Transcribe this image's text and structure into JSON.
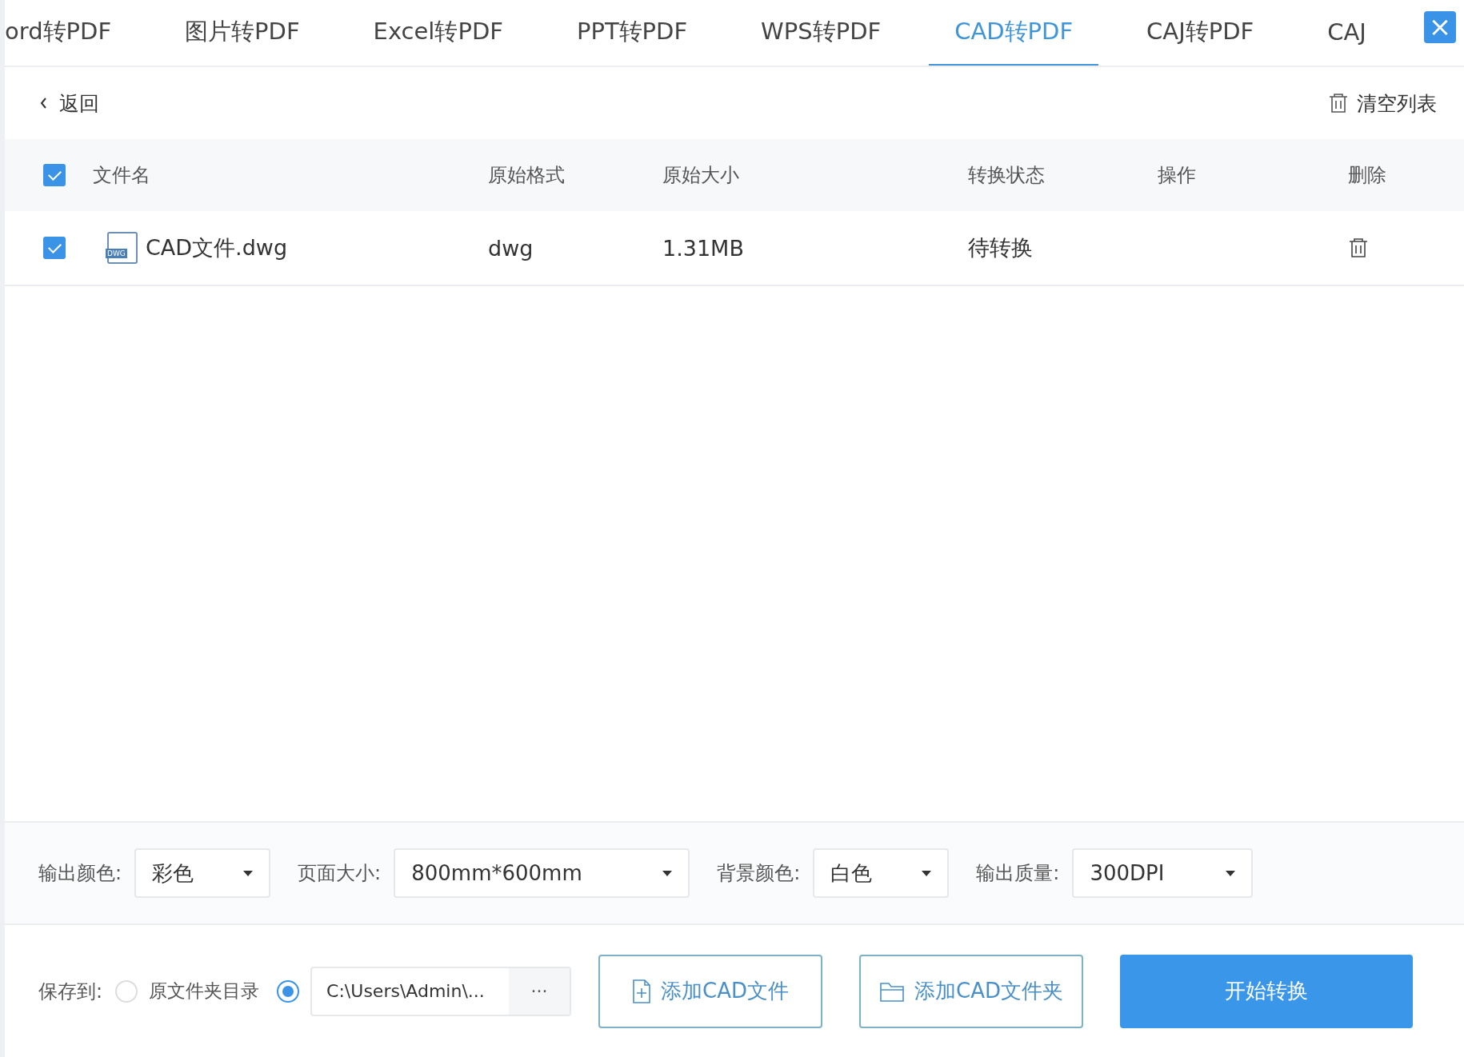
{
  "tabs": [
    {
      "label": "ord转PDF",
      "selected": false
    },
    {
      "label": "图片转PDF",
      "selected": false
    },
    {
      "label": "Excel转PDF",
      "selected": false
    },
    {
      "label": "PPT转PDF",
      "selected": false
    },
    {
      "label": "WPS转PDF",
      "selected": false
    },
    {
      "label": "CAD转PDF",
      "selected": true
    },
    {
      "label": "CAJ转PDF",
      "selected": false
    },
    {
      "label": "CAJ",
      "selected": false
    }
  ],
  "close_button": "×",
  "back_link": "返回",
  "clear_button": "清空列表",
  "table": {
    "all_checked": true,
    "columns": [
      "文件名",
      "原始格式",
      "原始大小",
      "转换状态",
      "操作",
      "删除"
    ],
    "rows": [
      {
        "checked": true,
        "file_name": "CAD文件.dwg",
        "file_badge": "DWG",
        "format": "dwg",
        "size": "1.31MB",
        "status": "待转换"
      }
    ]
  },
  "options": [
    {
      "label": "输出颜色:",
      "value": "彩色",
      "kind": "short"
    },
    {
      "label": "页面大小:",
      "value": "800mm*600mm",
      "kind": "wide"
    },
    {
      "label": "背景颜色:",
      "value": "白色",
      "kind": "short"
    },
    {
      "label": "输出质量:",
      "value": "300DPI",
      "kind": "medium"
    }
  ],
  "save_to": {
    "label": "保存到:",
    "choices": [
      {
        "label": "原文件夹目录",
        "selected": false
      },
      {
        "path": "C:\\Users\\Admin\\...",
        "browse": "···",
        "selected": true
      }
    ]
  },
  "buttons": [
    {
      "label": "添加CAD文件",
      "kind": "file"
    },
    {
      "label": "添加CAD文件夹",
      "kind": "folder"
    },
    {
      "label": "开始转换",
      "kind": "primary"
    }
  ]
}
